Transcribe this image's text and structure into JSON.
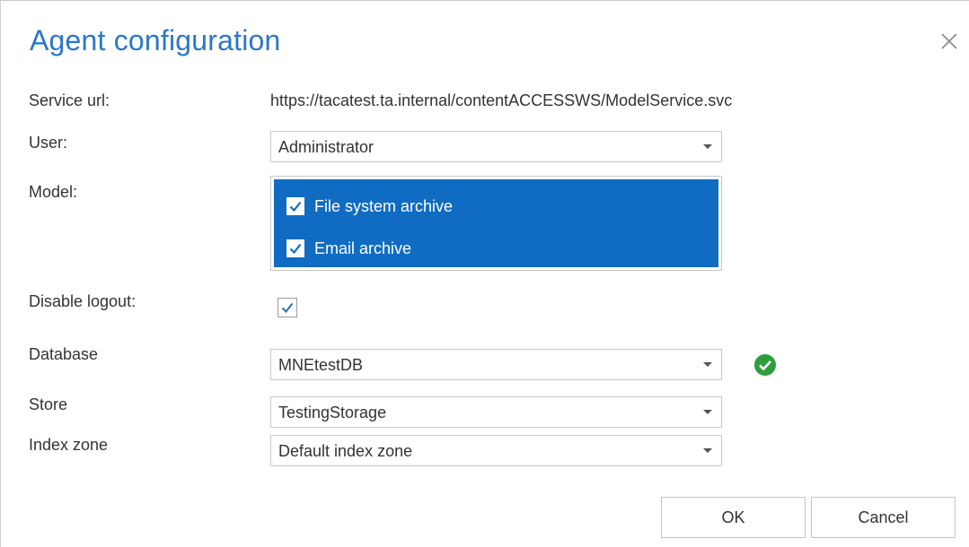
{
  "dialog": {
    "title": "Agent configuration",
    "close_icon": "close-icon"
  },
  "fields": {
    "service_url": {
      "label": "Service url:",
      "value": "https://tacatest.ta.internal/contentACCESSWS/ModelService.svc"
    },
    "user": {
      "label": "User:",
      "value": "Administrator"
    },
    "model": {
      "label": "Model:",
      "options": [
        {
          "label": "File system archive",
          "checked": true
        },
        {
          "label": "Email archive",
          "checked": true
        }
      ]
    },
    "disable_logout": {
      "label": "Disable logout:",
      "checked": true
    },
    "database": {
      "label": "Database",
      "value": "MNEtestDB",
      "status_icon": "check-circle-icon",
      "status_color": "#2e9e3a"
    },
    "store": {
      "label": "Store",
      "value": "TestingStorage"
    },
    "index_zone": {
      "label": "Index zone",
      "value": "Default index zone"
    }
  },
  "buttons": {
    "ok": "OK",
    "cancel": "Cancel"
  },
  "colors": {
    "title": "#2b77c9",
    "selection": "#0f6cc2"
  }
}
